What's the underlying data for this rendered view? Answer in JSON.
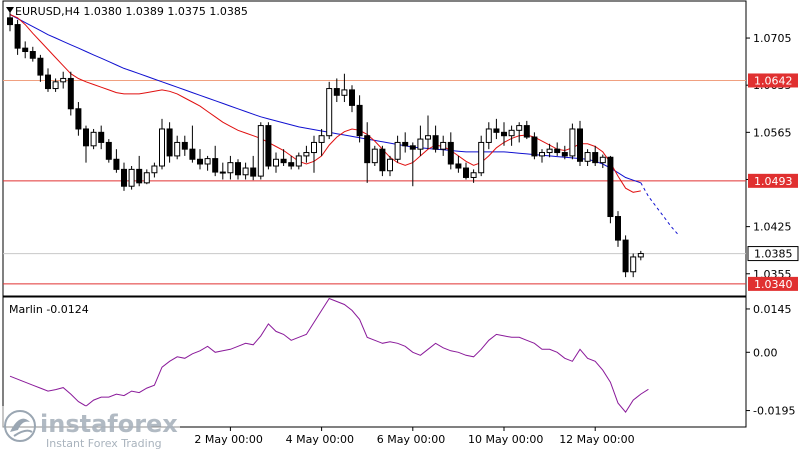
{
  "header": {
    "symbol_line": "EURUSD,H4  1.0380 1.0389 1.0375 1.0385"
  },
  "indicator": {
    "label": "Marlin -0.0124"
  },
  "watermark": {
    "brand": "instaforex",
    "tagline": "Instant Forex Trading"
  },
  "colors": {
    "candle": "#000000",
    "ma_fast": "#e01010",
    "ma_slow": "#1010d0",
    "marlin": "#8a1a9a",
    "level_line": "#e03030",
    "level_line_light": "#f0a080",
    "label_bg": "#e03030"
  },
  "chart_data": {
    "type": "candlestick",
    "symbol": "EURUSD",
    "timeframe": "H4",
    "price_axis": {
      "ticks": [
        "1.0705",
        "1.0635",
        "1.0565",
        "1.0495",
        "1.0425",
        "1.0355"
      ],
      "tick_values": [
        1.0705,
        1.0635,
        1.0565,
        1.0495,
        1.0425,
        1.0355
      ],
      "range": [
        1.0322,
        1.076
      ]
    },
    "levels": [
      {
        "value": 1.0642,
        "label": "1.0642",
        "style": "light"
      },
      {
        "value": 1.0493,
        "label": "1.0493",
        "style": "solid"
      },
      {
        "value": 1.034,
        "label": "1.0340",
        "style": "solid"
      }
    ],
    "current_price": {
      "value": 1.0385,
      "label": "1.0385"
    },
    "time_axis": {
      "labels": [
        "2 May 00:00",
        "4 May 00:00",
        "6 May 00:00",
        "10 May 00:00",
        "12 May 00:00"
      ],
      "label_indices": [
        29,
        41,
        53,
        65,
        77
      ]
    },
    "candles": [
      [
        1.0735,
        1.0745,
        1.0715,
        1.0725
      ],
      [
        1.0725,
        1.0732,
        1.068,
        1.069
      ],
      [
        1.069,
        1.07,
        1.0675,
        1.0685
      ],
      [
        1.0685,
        1.0692,
        1.067,
        1.0675
      ],
      [
        1.0675,
        1.068,
        1.064,
        1.065
      ],
      [
        1.065,
        1.066,
        1.0625,
        1.063
      ],
      [
        1.063,
        1.0645,
        1.0625,
        1.064
      ],
      [
        1.064,
        1.0655,
        1.063,
        1.0645
      ],
      [
        1.0645,
        1.0655,
        1.059,
        1.06
      ],
      [
        1.06,
        1.061,
        1.056,
        1.057
      ],
      [
        1.057,
        1.0575,
        1.052,
        1.0545
      ],
      [
        1.0545,
        1.057,
        1.054,
        1.0565
      ],
      [
        1.0565,
        1.0575,
        1.054,
        1.055
      ],
      [
        1.055,
        1.0555,
        1.052,
        1.0525
      ],
      [
        1.0525,
        1.054,
        1.0505,
        1.051
      ],
      [
        1.051,
        1.052,
        1.0478,
        1.0485
      ],
      [
        1.0485,
        1.0515,
        1.048,
        1.051
      ],
      [
        1.051,
        1.053,
        1.0485,
        1.049
      ],
      [
        1.049,
        1.051,
        1.0488,
        1.0505
      ],
      [
        1.0505,
        1.052,
        1.0498,
        1.0515
      ],
      [
        1.0515,
        1.0585,
        1.051,
        1.057
      ],
      [
        1.057,
        1.058,
        1.052,
        1.053
      ],
      [
        1.053,
        1.056,
        1.0525,
        1.055
      ],
      [
        1.055,
        1.056,
        1.053,
        1.054
      ],
      [
        1.054,
        1.0575,
        1.052,
        1.0525
      ],
      [
        1.0525,
        1.054,
        1.051,
        1.0518
      ],
      [
        1.0518,
        1.053,
        1.0508,
        1.0526
      ],
      [
        1.0526,
        1.0545,
        1.05,
        1.0506
      ],
      [
        1.0506,
        1.052,
        1.0495,
        1.0505
      ],
      [
        1.0505,
        1.053,
        1.0495,
        1.052
      ],
      [
        1.052,
        1.0525,
        1.0495,
        1.0502
      ],
      [
        1.0502,
        1.052,
        1.0495,
        1.0512
      ],
      [
        1.0512,
        1.053,
        1.0494,
        1.05
      ],
      [
        1.05,
        1.058,
        1.0495,
        1.0575
      ],
      [
        1.0575,
        1.058,
        1.051,
        1.0515
      ],
      [
        1.0515,
        1.0535,
        1.0505,
        1.0525
      ],
      [
        1.0525,
        1.054,
        1.0515,
        1.052
      ],
      [
        1.052,
        1.053,
        1.051,
        1.0515
      ],
      [
        1.0515,
        1.0535,
        1.051,
        1.053
      ],
      [
        1.053,
        1.0545,
        1.052,
        1.0535
      ],
      [
        1.0535,
        1.056,
        1.0505,
        1.055
      ],
      [
        1.055,
        1.057,
        1.053,
        1.056
      ],
      [
        1.056,
        1.064,
        1.0555,
        1.063
      ],
      [
        1.063,
        1.0645,
        1.061,
        1.062
      ],
      [
        1.062,
        1.0652,
        1.061,
        1.0628
      ],
      [
        1.0628,
        1.0635,
        1.0595,
        1.0605
      ],
      [
        1.0605,
        1.062,
        1.055,
        1.056
      ],
      [
        1.056,
        1.058,
        1.049,
        1.052
      ],
      [
        1.052,
        1.0545,
        1.0515,
        1.054
      ],
      [
        1.054,
        1.0545,
        1.05,
        1.0508
      ],
      [
        1.0508,
        1.053,
        1.05,
        1.0525
      ],
      [
        1.0525,
        1.056,
        1.052,
        1.055
      ],
      [
        1.055,
        1.0565,
        1.0535,
        1.0545
      ],
      [
        1.0545,
        1.055,
        1.0485,
        1.054
      ],
      [
        1.054,
        1.0575,
        1.053,
        1.0555
      ],
      [
        1.0555,
        1.059,
        1.054,
        1.056
      ],
      [
        1.056,
        1.0575,
        1.0535,
        1.054
      ],
      [
        1.054,
        1.056,
        1.053,
        1.055
      ],
      [
        1.055,
        1.0565,
        1.051,
        1.0518
      ],
      [
        1.0518,
        1.053,
        1.0505,
        1.0512
      ],
      [
        1.0512,
        1.052,
        1.0495,
        1.0498
      ],
      [
        1.0498,
        1.051,
        1.049,
        1.0505
      ],
      [
        1.0505,
        1.056,
        1.05,
        1.055
      ],
      [
        1.055,
        1.058,
        1.054,
        1.057
      ],
      [
        1.057,
        1.0585,
        1.0555,
        1.0565
      ],
      [
        1.0565,
        1.058,
        1.0545,
        1.056
      ],
      [
        1.056,
        1.0575,
        1.0545,
        1.0568
      ],
      [
        1.0568,
        1.058,
        1.055,
        1.0575
      ],
      [
        1.0575,
        1.0582,
        1.0555,
        1.0558
      ],
      [
        1.0558,
        1.0565,
        1.0525,
        1.053
      ],
      [
        1.053,
        1.054,
        1.052,
        1.0535
      ],
      [
        1.0535,
        1.0548,
        1.0528,
        1.054
      ],
      [
        1.054,
        1.055,
        1.053,
        1.0535
      ],
      [
        1.0535,
        1.0545,
        1.0525,
        1.053
      ],
      [
        1.053,
        1.0578,
        1.0525,
        1.057
      ],
      [
        1.057,
        1.0582,
        1.0515,
        1.0522
      ],
      [
        1.0522,
        1.054,
        1.0515,
        1.0535
      ],
      [
        1.0535,
        1.0545,
        1.0515,
        1.052
      ],
      [
        1.052,
        1.0532,
        1.0512,
        1.0528
      ],
      [
        1.0528,
        1.053,
        1.043,
        1.044
      ],
      [
        1.044,
        1.0448,
        1.0395,
        1.0405
      ],
      [
        1.0405,
        1.0412,
        1.035,
        1.0358
      ],
      [
        1.0358,
        1.0385,
        1.035,
        1.038
      ],
      [
        1.038,
        1.0389,
        1.0375,
        1.0385
      ]
    ],
    "ma_fast": [
      1.074,
      1.0735,
      1.0725,
      1.0712,
      1.07,
      1.0688,
      1.0676,
      1.0664,
      1.0652,
      1.0645,
      1.064,
      1.0636,
      1.0632,
      1.0628,
      1.0624,
      1.0622,
      1.0622,
      1.0622,
      1.0624,
      1.0626,
      1.0628,
      1.0626,
      1.0622,
      1.0616,
      1.061,
      1.0604,
      1.0596,
      1.0588,
      1.058,
      1.0574,
      1.0568,
      1.0564,
      1.056,
      1.0556,
      1.055,
      1.0544,
      1.0538,
      1.053,
      1.0522,
      1.0518,
      1.0522,
      1.053,
      1.0546,
      1.0558,
      1.0566,
      1.057,
      1.0568,
      1.0562,
      1.0552,
      1.054,
      1.0528,
      1.052,
      1.0516,
      1.052,
      1.053,
      1.054,
      1.0546,
      1.0544,
      1.0538,
      1.053,
      1.0522,
      1.0516,
      1.052,
      1.053,
      1.0542,
      1.055,
      1.0556,
      1.056,
      1.0561,
      1.0558,
      1.0552,
      1.0546,
      1.054,
      1.0538,
      1.0542,
      1.0548,
      1.0548,
      1.0544,
      1.0536,
      1.052,
      1.05,
      1.0482,
      1.0476,
      1.0478
    ],
    "ma_slow": [
      1.074,
      1.0734,
      1.0728,
      1.0722,
      1.0716,
      1.071,
      1.0705,
      1.07,
      1.0695,
      1.069,
      1.0685,
      1.068,
      1.0675,
      1.067,
      1.0665,
      1.066,
      1.0656,
      1.0652,
      1.0648,
      1.0644,
      1.064,
      1.0636,
      1.0632,
      1.0628,
      1.0624,
      1.062,
      1.0616,
      1.0612,
      1.0608,
      1.0604,
      1.06,
      1.0596,
      1.0592,
      1.0588,
      1.0585,
      1.0582,
      1.0579,
      1.0576,
      1.0573,
      1.0571,
      1.0569,
      1.0567,
      1.0565,
      1.0563,
      1.0561,
      1.0559,
      1.0557,
      1.0555,
      1.0553,
      1.0551,
      1.0549,
      1.0547,
      1.0545,
      1.0543,
      1.0542,
      1.0541,
      1.054,
      1.0539,
      1.0538,
      1.0537,
      1.0536,
      1.0536,
      1.0536,
      1.0536,
      1.0536,
      1.0536,
      1.0535,
      1.0534,
      1.0533,
      1.0532,
      1.0531,
      1.053,
      1.0529,
      1.0528,
      1.0527,
      1.0526,
      1.0525,
      1.0522,
      1.0518,
      1.0512,
      1.0505,
      1.0498,
      1.0494,
      1.049
    ],
    "ma_slow_projection": [
      1.049,
      1.047,
      1.0455,
      1.044,
      1.0425,
      1.0412
    ],
    "indicator": {
      "name": "Marlin",
      "ticks": [
        "0.0145",
        "0.00",
        "-0.0195"
      ],
      "tick_values": [
        0.0145,
        0.0,
        -0.0195
      ],
      "range": [
        -0.025,
        0.0185
      ],
      "values": [
        -0.008,
        -0.009,
        -0.01,
        -0.011,
        -0.012,
        -0.013,
        -0.0125,
        -0.0118,
        -0.014,
        -0.0165,
        -0.018,
        -0.016,
        -0.015,
        -0.015,
        -0.014,
        -0.0145,
        -0.013,
        -0.0135,
        -0.012,
        -0.011,
        -0.005,
        -0.003,
        -0.0015,
        -0.002,
        -0.0005,
        0.0005,
        0.002,
        0.0,
        0.0005,
        0.001,
        0.002,
        0.003,
        0.0025,
        0.0055,
        0.0095,
        0.007,
        0.006,
        0.004,
        0.005,
        0.006,
        0.01,
        0.014,
        0.018,
        0.017,
        0.016,
        0.014,
        0.011,
        0.005,
        0.004,
        0.003,
        0.0035,
        0.003,
        0.002,
        0.0,
        -0.001,
        0.001,
        0.003,
        0.0015,
        0.0005,
        0.0,
        -0.001,
        -0.0015,
        0.001,
        0.004,
        0.006,
        0.0055,
        0.005,
        0.005,
        0.004,
        0.003,
        0.001,
        0.001,
        0.0,
        -0.002,
        -0.003,
        0.001,
        -0.002,
        -0.003,
        -0.006,
        -0.01,
        -0.017,
        -0.02,
        -0.016,
        -0.014,
        -0.0124
      ]
    }
  }
}
